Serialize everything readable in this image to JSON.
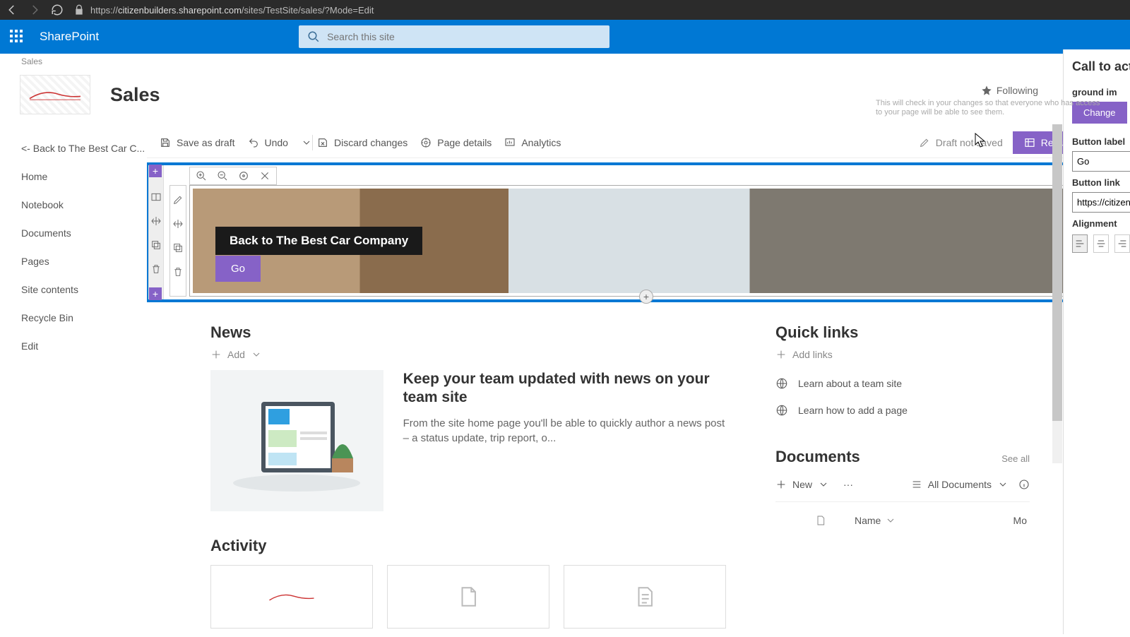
{
  "browser": {
    "url_prefix": "https://",
    "url_host": "citizenbuilders.sharepoint.com",
    "url_path": "/sites/TestSite/sales/?Mode=Edit"
  },
  "suite": {
    "title": "SharePoint",
    "search_placeholder": "Search this site"
  },
  "site": {
    "crumb": "Sales",
    "name": "Sales",
    "following": "Following"
  },
  "tooltip": "This will check in your changes so that everyone who has access to your page will be able to see them.",
  "nav": {
    "items": [
      "<- Back to The Best Car C...",
      "Home",
      "Notebook",
      "Documents",
      "Pages",
      "Site contents",
      "Recycle Bin",
      "Edit"
    ]
  },
  "cmd": {
    "save": "Save as draft",
    "undo": "Undo",
    "discard": "Discard changes",
    "details": "Page details",
    "analytics": "Analytics",
    "draft_status": "Draft not saved",
    "republish": "Republish"
  },
  "hero": {
    "title": "Back to The Best Car Company",
    "button": "Go"
  },
  "news": {
    "heading": "News",
    "add": "Add",
    "headline": "Keep your team updated with news on your team site",
    "body": "From the site home page you'll be able to quickly author a news post – a status update, trip report, o..."
  },
  "activity": {
    "heading": "Activity"
  },
  "quicklinks": {
    "heading": "Quick links",
    "add": "Add links",
    "items": [
      "Learn about a team site",
      "Learn how to add a page"
    ]
  },
  "documents": {
    "heading": "Documents",
    "seeall": "See all",
    "new": "New",
    "view": "All Documents",
    "col_name": "Name",
    "col_mod": "Mo"
  },
  "pane": {
    "title": "Call to acti",
    "bg_label": "ground im",
    "change": "Change",
    "btn_label": "Button label",
    "btn_label_val": "Go",
    "btn_link": "Button link",
    "btn_link_val": "https://citizen",
    "align": "Alignment"
  }
}
